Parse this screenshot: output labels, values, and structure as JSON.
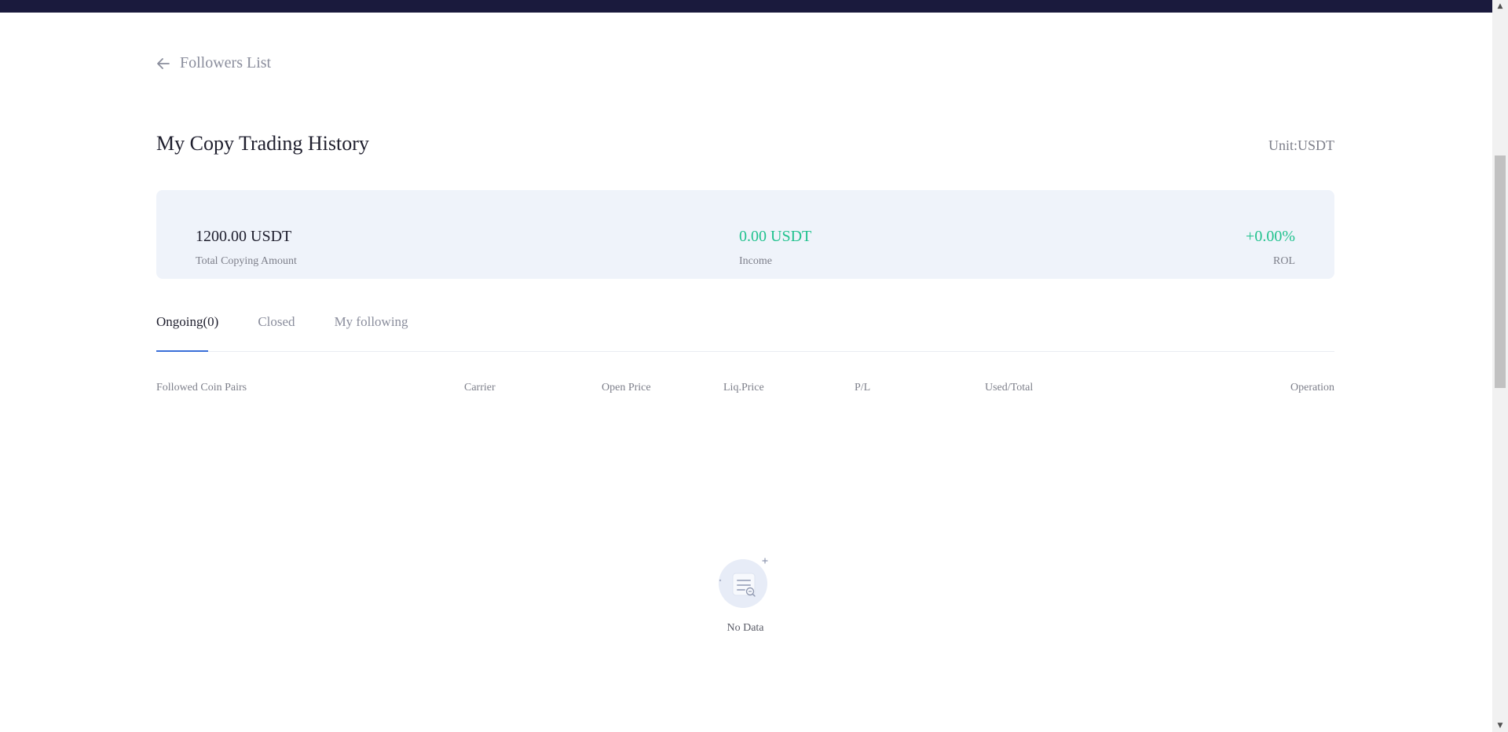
{
  "nav": {
    "back_label": "Followers List"
  },
  "header": {
    "title": "My Copy Trading History",
    "unit": "Unit:USDT"
  },
  "summary": {
    "total": {
      "value": "1200.00 USDT",
      "label": "Total Copying Amount"
    },
    "income": {
      "value": "0.00 USDT",
      "label": "Income"
    },
    "rol": {
      "value": "+0.00%",
      "label": "ROL"
    }
  },
  "tabs": [
    {
      "label": "Ongoing(0)",
      "active": true
    },
    {
      "label": "Closed",
      "active": false
    },
    {
      "label": "My following",
      "active": false
    }
  ],
  "table": {
    "columns": [
      "Followed Coin Pairs",
      "Carrier",
      "Open Price",
      "Liq.Price",
      "P/L",
      "Used/Total",
      "Operation"
    ]
  },
  "empty_state": {
    "text": "No Data",
    "icon": "empty-document-icon"
  },
  "colors": {
    "topbar": "#1a1a3d",
    "positive": "#21c28e",
    "accent": "#3a6fd8",
    "summary_bg": "#eff3fa"
  }
}
